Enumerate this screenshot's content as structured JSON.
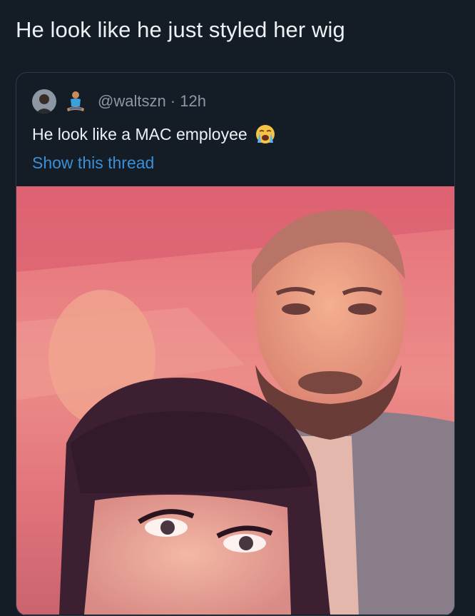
{
  "tweet": {
    "text": "He look like he just styled her wig"
  },
  "quoted_tweet": {
    "handle": "@waltszn",
    "time": "12h",
    "handle_line": "@waltszn · 12h",
    "text": "He look like a MAC employee",
    "emoji": "loudly-crying-face",
    "show_thread_label": "Show this thread",
    "link_color": "#3b8fd6",
    "avatar_icon": "user-avatar",
    "badge_icon": "person-in-lotus-position-emoji",
    "photo_icon": "selfie-photo"
  }
}
